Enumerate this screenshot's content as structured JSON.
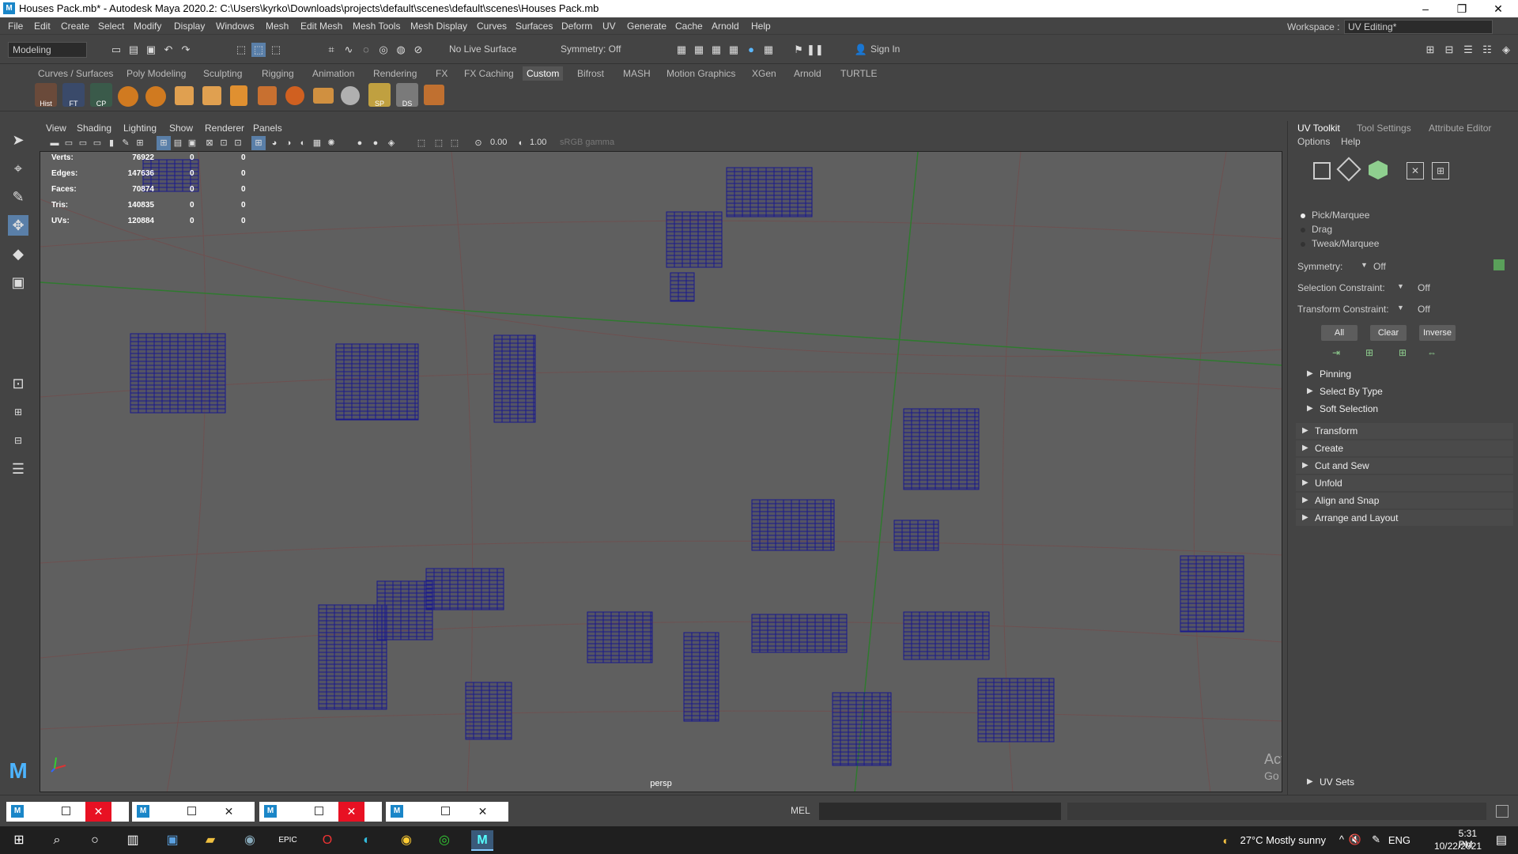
{
  "window": {
    "title": "Houses Pack.mb* - Autodesk Maya 2020.2: C:\\Users\\kyrko\\Downloads\\projects\\default\\scenes\\default\\scenes\\Houses Pack.mb",
    "minimize": "–",
    "maximize": "❐",
    "close": "✕"
  },
  "menu": [
    "File",
    "Edit",
    "Create",
    "Select",
    "Modify",
    "Display",
    "Windows",
    "Mesh",
    "Edit Mesh",
    "Mesh Tools",
    "Mesh Display",
    "Curves",
    "Surfaces",
    "Deform",
    "UV",
    "Generate",
    "Cache",
    "Arnold",
    "Help"
  ],
  "workspace": {
    "label": "Workspace :",
    "value": "UV Editing*"
  },
  "statusline": {
    "mode": "Modeling",
    "live_surface": "No Live Surface",
    "symmetry": "Symmetry: Off",
    "sign_in": "Sign In"
  },
  "shelf_tabs": [
    "Curves / Surfaces",
    "Poly Modeling",
    "Sculpting",
    "Rigging",
    "Animation",
    "Rendering",
    "FX",
    "FX Caching",
    "Custom",
    "Bifrost",
    "MASH",
    "Motion Graphics",
    "XGen",
    "Arnold",
    "TURTLE"
  ],
  "shelf_active": "Custom",
  "shelf_labels": [
    "Hist",
    "FT",
    "CP",
    "SP",
    "DS"
  ],
  "viewport": {
    "menu": [
      "View",
      "Shading",
      "Lighting",
      "Show",
      "Renderer",
      "Panels"
    ],
    "field1": "0.00",
    "field2": "1.00",
    "colorspace": "sRGB gamma",
    "camera": "persp",
    "hud": [
      {
        "label": "Verts:",
        "v1": "76922",
        "v2": "0",
        "v3": "0"
      },
      {
        "label": "Edges:",
        "v1": "147636",
        "v2": "0",
        "v3": "0"
      },
      {
        "label": "Faces:",
        "v1": "70874",
        "v2": "0",
        "v3": "0"
      },
      {
        "label": "Tris:",
        "v1": "140835",
        "v2": "0",
        "v3": "0"
      },
      {
        "label": "UVs:",
        "v1": "120884",
        "v2": "0",
        "v3": "0"
      }
    ],
    "watermark_line1": "Activate Windows",
    "watermark_line2": "Go to Settings to activate Windows."
  },
  "right_panel": {
    "tabs": [
      "UV Toolkit",
      "Tool Settings",
      "Attribute Editor"
    ],
    "submenu": [
      "Options",
      "Help"
    ],
    "modes": [
      "Pick/Marquee",
      "Drag",
      "Tweak/Marquee"
    ],
    "symmetry_label": "Symmetry:",
    "symmetry_value": "Off",
    "sel_constraint_label": "Selection Constraint:",
    "sel_constraint_value": "Off",
    "xform_constraint_label": "Transform Constraint:",
    "xform_constraint_value": "Off",
    "buttons": [
      "All",
      "Clear",
      "Inverse"
    ],
    "subsections": [
      "Pinning",
      "Select By Type",
      "Soft Selection"
    ],
    "sections": [
      "Transform",
      "Create",
      "Cut and Sew",
      "Unfold",
      "Align and Snap",
      "Arrange and Layout"
    ],
    "uv_sets": "UV Sets"
  },
  "cmdline": {
    "label": "MEL"
  },
  "taskbar": {
    "weather": "27°C  Mostly sunny",
    "lang": "ENG",
    "time": "5:31 PM",
    "date": "10/22/2021"
  },
  "colors": {
    "wire": "#1a1a8c",
    "grid_red": "#8a3a3a",
    "grid_green": "#2f7a2f",
    "viewport_bg": "#5f5f5f"
  }
}
